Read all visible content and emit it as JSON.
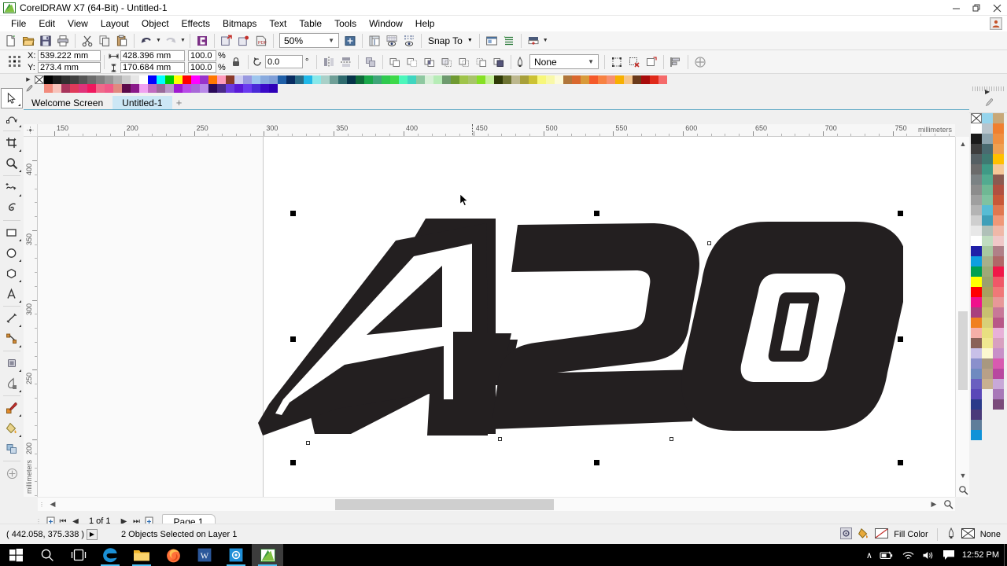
{
  "window": {
    "title": "CorelDRAW X7 (64-Bit) - Untitled-1",
    "app_icon": "coreldraw-logo-icon",
    "minimize": "—",
    "maximize": "❐",
    "close": "✕"
  },
  "menubar": {
    "items": [
      {
        "label": "File",
        "accel": "F"
      },
      {
        "label": "Edit",
        "accel": "E"
      },
      {
        "label": "View",
        "accel": "V"
      },
      {
        "label": "Layout",
        "accel": "L"
      },
      {
        "label": "Object",
        "accel": "O"
      },
      {
        "label": "Effects",
        "accel": "c"
      },
      {
        "label": "Bitmaps",
        "accel": "B"
      },
      {
        "label": "Text",
        "accel": "x"
      },
      {
        "label": "Table",
        "accel": "T"
      },
      {
        "label": "Tools",
        "accel": "o"
      },
      {
        "label": "Window",
        "accel": "W"
      },
      {
        "label": "Help",
        "accel": "H"
      }
    ]
  },
  "standard_toolbar": {
    "buttons": [
      "new-document-icon",
      "open-document-icon",
      "save-icon",
      "print-icon",
      "cut-icon",
      "copy-icon",
      "paste-icon",
      "undo-icon",
      "redo-icon",
      "import-icon",
      "export-icon",
      "export-to-pdf-icon",
      "publish-pdf-icon"
    ],
    "zoom_level": "50%",
    "zoom_fit_icon": "zoom-to-fit-icon",
    "view_icons": [
      "show-rulers-icon",
      "show-grid-icon",
      "show-guidelines-icon"
    ],
    "snap_to_label": "Snap To",
    "options_icons": [
      "options-icon",
      "object-manager-icon",
      "application-launcher-icon"
    ]
  },
  "property_bar": {
    "anchor_icon": "object-origin-anchor-icon",
    "x_label": "X:",
    "x_value": "539.222 mm",
    "y_label": "Y:",
    "y_value": "273.4 mm",
    "width_icon": "object-width-icon",
    "width_value": "428.396 mm",
    "height_icon": "object-height-icon",
    "height_value": "170.684 mm",
    "scale_h": "100.0",
    "scale_v": "100.0",
    "percent_symbol": "%",
    "lock_ratio_icon": "lock-ratio-icon",
    "rotate_icon": "rotation-angle-icon",
    "rotation_value": "0.0",
    "degree_symbol": "°",
    "mirror_icons": [
      "mirror-horizontal-icon",
      "mirror-vertical-icon"
    ],
    "group_icons": [
      "group-icon",
      "ungroup-icon"
    ],
    "shaping_icons": [
      "weld-icon",
      "trim-icon",
      "intersect-icon",
      "simplify-icon",
      "front-minus-back-icon",
      "back-minus-front-icon",
      "boundary-icon"
    ],
    "outline_icon": "outline-width-icon",
    "outline_width": "None",
    "convert_icons": [
      "convert-to-curves-icon",
      "remove-outline-icon",
      "wrap-paragraph-text-icon"
    ],
    "align_icon": "align-and-distribute-icon",
    "edit_fill_icon": "edit-fill-icon"
  },
  "color_palette_top": {
    "row1": [
      "#0000ff",
      "#00ffff",
      "#00cc00",
      "#ffff00",
      "#ff0000",
      "#ff00ff",
      "#9933cc",
      "#ff7700",
      "#ff99bb",
      "#8b3a2a",
      "#ccccf0",
      "#9999e0",
      "#9ec6ee",
      "#88aade",
      "#7f9fd8",
      "#1f5fa8",
      "#082c62",
      "#2a6b86",
      "#20b8e8",
      "#88e8ea",
      "#a8d0c8",
      "#6f9f97",
      "#2e6b6e",
      "#07344a",
      "#0f6b3a",
      "#1aa84a",
      "#3fa579",
      "#2fc94f",
      "#3ed94a",
      "#4cf7bb",
      "#3fd6c0",
      "#8ec8a0",
      "#d7f0d7",
      "#b6ecb6",
      "#6e9a6e",
      "#6f9a33",
      "#9fc44a",
      "#a8c46a",
      "#86e024",
      "#c5f098",
      "#2f3a06",
      "#6e7433",
      "#bdb88e",
      "#a8a03a",
      "#ccc233",
      "#f7f77a",
      "#f8f8a8",
      "#fdfbd8",
      "#b0763a",
      "#d9682e",
      "#d99a3a",
      "#f55a2a",
      "#f78242",
      "#f79070",
      "#f7b000",
      "#f5c58a",
      "#6b3a1a",
      "#a80b0b",
      "#e02a1a",
      "#f56a6a"
    ],
    "row2": [
      "#f28b7d",
      "#f7c3bb",
      "#a8355c",
      "#e03a5a",
      "#e0337a",
      "#f0185e",
      "#f06a8a",
      "#f05a88",
      "#e08a80",
      "#5c0a4a",
      "#8a1a8a",
      "#f0a0f0",
      "#c06ac0",
      "#9a6a9a",
      "#b898c8",
      "#a01ad0",
      "#b84ae8",
      "#a868d8",
      "#b888e8",
      "#2a0a5a",
      "#4a2a8a",
      "#6a3ae0",
      "#5a1ad8",
      "#6a3af0",
      "#4a2ad8",
      "#3a0ac8",
      "#2e00b8"
    ],
    "none_swatch": "no-color-icon"
  },
  "document_tabs": {
    "tabs": [
      {
        "label": "Welcome Screen",
        "active": false
      },
      {
        "label": "Untitled-1",
        "active": true
      }
    ],
    "add_label": "+"
  },
  "toolbox": {
    "tools": [
      {
        "name": "pick-tool",
        "icon": "arrow-cursor-icon",
        "selected": true
      },
      {
        "name": "shape-tool",
        "icon": "node-edit-icon",
        "selected": false
      },
      {
        "name": "crop-tool",
        "icon": "crop-icon",
        "selected": false
      },
      {
        "name": "zoom-tool",
        "icon": "magnifier-icon",
        "selected": false
      },
      {
        "name": "freehand-tool",
        "icon": "freehand-curve-icon",
        "selected": false
      },
      {
        "name": "artistic-media-tool",
        "icon": "artistic-media-icon",
        "selected": false
      },
      {
        "name": "rectangle-tool",
        "icon": "rectangle-icon",
        "selected": false
      },
      {
        "name": "ellipse-tool",
        "icon": "ellipse-icon",
        "selected": false
      },
      {
        "name": "polygon-tool",
        "icon": "polygon-icon",
        "selected": false
      },
      {
        "name": "text-tool",
        "icon": "letter-a-icon",
        "selected": false
      },
      {
        "name": "parallel-dimension-tool",
        "icon": "dimension-line-icon",
        "selected": false
      },
      {
        "name": "straight-line-connector-tool",
        "icon": "connector-icon",
        "selected": false
      },
      {
        "name": "drop-shadow-tool",
        "icon": "drop-shadow-icon",
        "selected": false
      },
      {
        "name": "transparency-tool",
        "icon": "transparency-icon",
        "selected": false
      },
      {
        "name": "color-eyedropper-tool",
        "icon": "eyedropper-icon",
        "selected": false
      },
      {
        "name": "interactive-fill-tool",
        "icon": "paint-bucket-icon",
        "selected": false
      },
      {
        "name": "smart-fill-tool",
        "icon": "smart-fill-icon",
        "selected": false
      },
      {
        "name": "quick-customize",
        "icon": "plus-circle-icon",
        "selected": false
      }
    ]
  },
  "rulers": {
    "unit_label": "millimeters",
    "h_labels": [
      "150",
      "200",
      "250",
      "300",
      "350",
      "400",
      "450",
      "500",
      "550",
      "600",
      "650",
      "700",
      "750"
    ],
    "v_labels": [
      "400",
      "350",
      "300",
      "250",
      "200"
    ]
  },
  "canvas": {
    "artwork_text": "420",
    "artwork_description": "stylized italic outlined numerals",
    "fill_color": "#231f20",
    "background": "#ffffff"
  },
  "page_nav": {
    "add_page_start_icon": "add-page-before-icon",
    "first_icon": "⏮",
    "prev_icon": "◀",
    "counter": "1 of 1",
    "next_icon": "▶",
    "last_icon": "⏭",
    "add_page_end_icon": "add-page-after-icon",
    "page_tab": "Page 1"
  },
  "status_bar": {
    "coordinates": "( 442.058, 375.338 )",
    "expand_icon": "expand-status-icon",
    "selection_info": "2 Objects Selected on Layer 1",
    "fill_icon": "fill-swatch-icon",
    "fill_bucket_icon": "paint-bucket-icon",
    "fill_none_icon": "no-fill-icon",
    "fill_label": "Fill Color",
    "outline_pen_icon": "outline-pen-icon",
    "outline_none_icon": "no-outline-icon",
    "outline_label": "None"
  },
  "right_palette": {
    "col1": [
      "#ffffff",
      "#1a1a1a",
      "#3d3d3d",
      "#555f63",
      "#6b6b6b",
      "#7b8284",
      "#8c8c8c",
      "#9f9f9f",
      "#b4b4b4",
      "#cfcfcf",
      "#e8e8e8",
      "#ffffff",
      "#2020a8",
      "#0f9fe0",
      "#00a050",
      "#ffff00",
      "#ff0000",
      "#f0108c",
      "#a8407e",
      "#f08020",
      "#f5b0a8",
      "#8a6258",
      "#c8c0e8",
      "#8a90cc",
      "#6f8ac0",
      "#6a5fc0",
      "#5a48b8",
      "#2a3a8a",
      "#4a3a7a",
      "#5f7d9a",
      "#0f92d8"
    ],
    "col2": [
      "#95d4ec",
      "#b8c4cc",
      "#8ea4ae",
      "#4a6a70",
      "#3f7a72",
      "#3f9a86",
      "#52ab90",
      "#6fb894",
      "#7fc2a0",
      "#57bcd4",
      "#3f9fb8",
      "#b0c0b8",
      "#c0dcc0",
      "#a8c8a0",
      "#a8b08a",
      "#9fa878",
      "#9aa070",
      "#a8a060",
      "#b8b068",
      "#c8c070",
      "#d8d078",
      "#e8e080",
      "#f0e890",
      "#fcf8d0",
      "#a89880",
      "#b8a088",
      "#c8b090"
    ],
    "col3": [
      "#c8a878",
      "#f08030",
      "#f09040",
      "#f0a050",
      "#ffc000",
      "#f5c898",
      "#8a5a50",
      "#b05040",
      "#c85838",
      "#e07850",
      "#f09878",
      "#f0b8a8",
      "#f0c8c8",
      "#b08088",
      "#b06868",
      "#f01848",
      "#f05868",
      "#f07878",
      "#e89898",
      "#c87898",
      "#b85888",
      "#e8b0d8",
      "#d8a0c0",
      "#c890c8",
      "#d85ab0",
      "#b848a0",
      "#c8a8d8",
      "#a878b8",
      "#7a4a7a"
    ]
  },
  "taskbar": {
    "items": [
      {
        "name": "start-button",
        "icon": "windows-logo-icon"
      },
      {
        "name": "search-button",
        "icon": "magnifier-icon"
      },
      {
        "name": "task-view-button",
        "icon": "task-view-icon"
      },
      {
        "name": "edge-button",
        "icon": "edge-browser-icon"
      },
      {
        "name": "file-explorer-button",
        "icon": "folder-icon"
      },
      {
        "name": "firefox-button",
        "icon": "firefox-icon"
      },
      {
        "name": "word-button",
        "icon": "word-document-icon"
      },
      {
        "name": "camera-button",
        "icon": "camera-app-icon"
      },
      {
        "name": "coreldraw-button",
        "icon": "coreldraw-logo-icon"
      }
    ],
    "tray": {
      "chevron": "∧",
      "battery_icon": "battery-icon",
      "wifi_icon": "wifi-icon",
      "volume_icon": "speaker-icon",
      "action_center_icon": "notification-icon",
      "clock": "12:52 PM"
    }
  }
}
